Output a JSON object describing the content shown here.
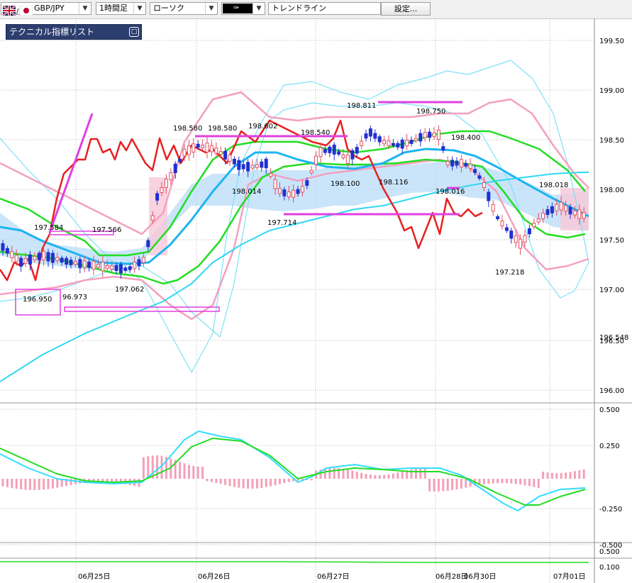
{
  "toolbar": {
    "pair": "GBP/JPY",
    "timeframe": "1時間足",
    "chart_style": "ローソク",
    "draw_tool": "トレンドライン",
    "settings_label": "設定..."
  },
  "indicator_panel": {
    "label": "テクニカル指標リスト"
  },
  "chart_data": [
    {
      "type": "candlestick",
      "pane": "price",
      "y_ticks": [
        "199.50",
        "199.00",
        "198.50",
        "198.00",
        "197.50",
        "197.00",
        "196.50",
        "196.00"
      ],
      "y_range": [
        195.88,
        199.63
      ],
      "current_price_label": "196.548",
      "x_ticks": [
        "06月25日",
        "06月26日",
        "06月27日",
        "06月28日",
        "06月30日",
        "07月01日"
      ],
      "price_labels": [
        "197.584",
        "197.566",
        "196.950",
        "96.973",
        "197.062",
        "198.580",
        "198.580",
        "198.602",
        "198.014",
        "197.714",
        "198.540",
        "198.100",
        "198.811",
        "198.116",
        "198.750",
        "198.400",
        "198.016",
        "198.018",
        "197.218"
      ],
      "overlays": [
        "一目均衡表 雲",
        "ボリンジャーバンド",
        "移動平均線",
        "遅行スパン",
        "水平線"
      ],
      "colors": {
        "up": "#e05060",
        "down": "#2030d0",
        "red_line": "#e82020",
        "green_ma": "#22dd22",
        "blue_ma": "#1cb4f0",
        "band_pink": "#f4a0c0",
        "band_cyan": "#7fe0f8",
        "cloud": "#b8dcf8",
        "hline": "#e040e0"
      }
    },
    {
      "type": "macd",
      "pane": "oscillator",
      "y_ticks": [
        "0.500",
        "0.250",
        "-0.250",
        "-0.500"
      ],
      "y_range": [
        -0.5,
        0.5
      ],
      "colors": {
        "macd": "#33ddff",
        "signal": "#22dd22",
        "histogram": "#f4a0b8"
      }
    },
    {
      "type": "line",
      "pane": "bottom",
      "y_ticks": [
        "0.500",
        "0.100"
      ]
    }
  ]
}
